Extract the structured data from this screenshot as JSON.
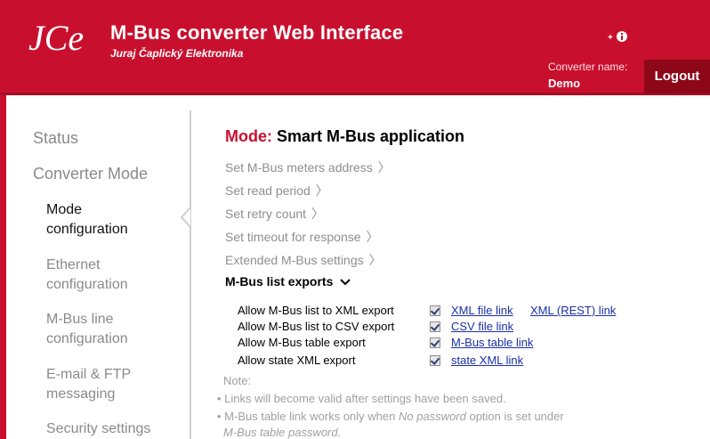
{
  "header": {
    "logo_text": "JCe",
    "title": "M-Bus converter Web Interface",
    "company": "Juraj Čaplický Elektronika",
    "converter_label": "Converter name:",
    "converter_name": "Demo",
    "logout_label": "Logout",
    "lang_icon": "info-circle-icon"
  },
  "sidebar": {
    "status": "Status",
    "converter_mode": "Converter Mode",
    "items": [
      {
        "line1": "Mode",
        "line2": "configuration"
      },
      {
        "line1": "Ethernet",
        "line2": "configuration"
      },
      {
        "line1": "M-Bus line",
        "line2": "configuration"
      },
      {
        "line1": "E-mail & FTP",
        "line2": "messaging"
      },
      {
        "line1": "Security settings",
        "line2": ""
      }
    ]
  },
  "main": {
    "mode_prefix": "Mode:",
    "mode_value": "Smart M-Bus application",
    "links": [
      "Set M-Bus meters address",
      "Set read period",
      "Set retry count",
      "Set timeout for response",
      "Extended M-Bus settings"
    ],
    "exports_title": "M-Bus list exports",
    "export_rows": [
      {
        "label": "Allow M-Bus list to XML export",
        "checked": true,
        "links": [
          "XML file link",
          "XML (REST) link"
        ]
      },
      {
        "label": "Allow M-Bus list to CSV export",
        "checked": true,
        "links": [
          "CSV file link"
        ]
      },
      {
        "label": "Allow M-Bus table export",
        "checked": true,
        "links": [
          "M-Bus table link"
        ]
      },
      {
        "label": "Allow state XML export",
        "checked": true,
        "links": [
          "state XML link"
        ]
      }
    ],
    "note_title": "Note:",
    "note1": "Links will become valid after settings have been saved.",
    "note2_pre": "M-Bus table link works only when ",
    "note2_em": "No password",
    "note2_post": " option is set under",
    "note3": "M-Bus table password."
  },
  "colors": {
    "brand_red": "#c8102e",
    "logout_bg": "#8e0719",
    "link_blue": "#1a2fa5"
  }
}
